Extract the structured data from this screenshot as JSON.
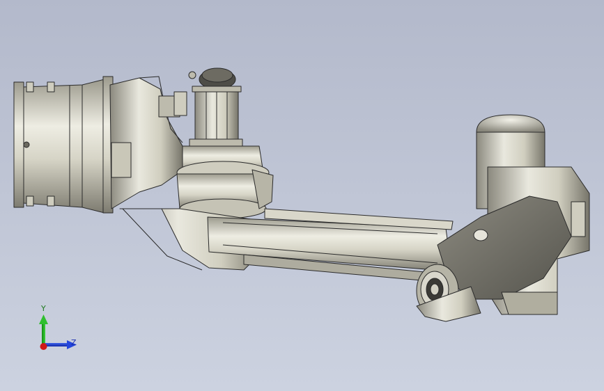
{
  "viewport": {
    "background_top": "#b3b9cb",
    "background_bottom": "#ccd2e0",
    "model_base_color": "#d8d6c7",
    "model_edge_color": "#2a2a2a"
  },
  "triad": {
    "y_label": "Y",
    "z_label": "Z",
    "y_color": "#23b123",
    "z_color": "#1f3fd6",
    "x_color": "#d01818"
  }
}
